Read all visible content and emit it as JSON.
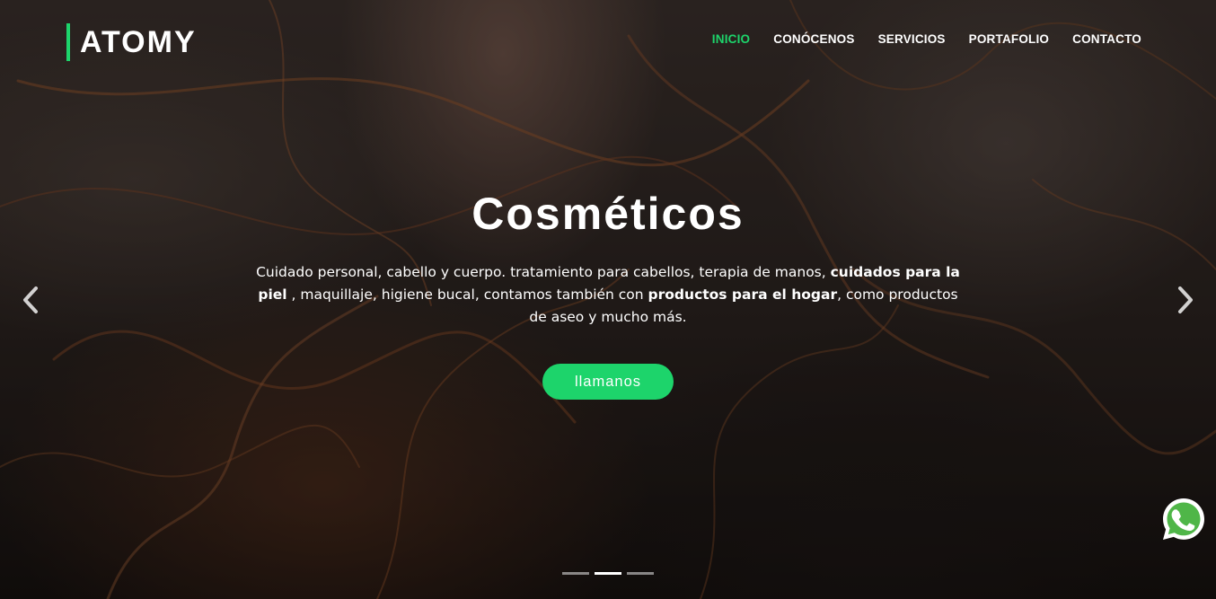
{
  "brand": {
    "name": "ATOMY",
    "accent": "#1dd46b"
  },
  "nav": {
    "items": [
      {
        "label": "INICIO",
        "active": true
      },
      {
        "label": "CONÓCENOS"
      },
      {
        "label": "SERVICIOS"
      },
      {
        "label": "PORTAFOLIO"
      },
      {
        "label": "CONTACTO"
      }
    ]
  },
  "hero": {
    "title": "Cosméticos",
    "desc": {
      "p1": "Cuidado personal, cabello y cuerpo. tratamiento para cabellos, terapia de manos, ",
      "b1": "cuidados para la piel",
      "p2": " , maquillaje, higiene bucal, contamos también con ",
      "b2": "productos para el hogar",
      "p3": ", como productos de aseo y mucho más."
    },
    "cta_label": "llamanos"
  },
  "carousel": {
    "slide_count": 3,
    "active_index": 1
  },
  "icons": {
    "prev": "chevron-left-icon",
    "next": "chevron-right-icon",
    "whatsapp": "whatsapp-icon"
  }
}
